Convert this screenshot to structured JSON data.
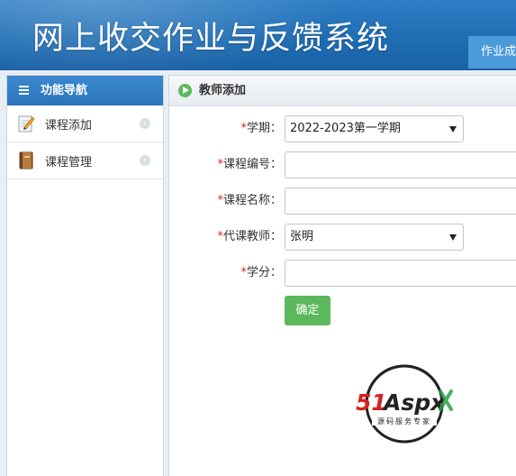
{
  "header": {
    "title": "网上收交作业与反馈系统",
    "tab_label": "作业成"
  },
  "sidebar": {
    "heading": "功能导航",
    "items": [
      {
        "label": "课程添加",
        "icon": "edit-note-icon"
      },
      {
        "label": "课程管理",
        "icon": "book-icon"
      }
    ]
  },
  "main": {
    "heading": "教师添加",
    "form": {
      "semester": {
        "label": "学期：",
        "value": "2022-2023第一学期"
      },
      "course_code": {
        "label": "课程编号：",
        "value": ""
      },
      "course_name": {
        "label": "课程名称：",
        "value": ""
      },
      "teacher": {
        "label": "代课教师：",
        "value": "张明"
      },
      "credit": {
        "label": "学分：",
        "value": ""
      },
      "required_mark": "*",
      "submit_label": "确定"
    }
  },
  "logo": {
    "brand": "51Aspx",
    "tagline": "源码服务专家"
  },
  "colors": {
    "header_blue": "#1f6db3",
    "accent_green": "#5cb85c",
    "required_red": "#e02020"
  }
}
